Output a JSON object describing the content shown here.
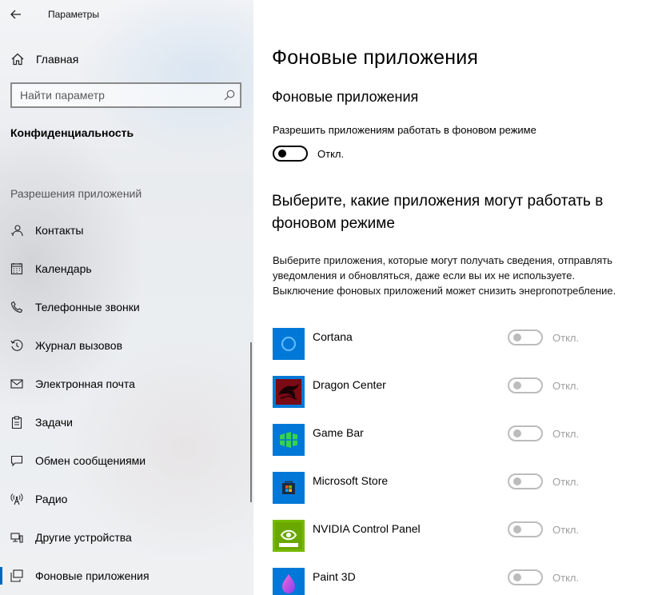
{
  "window": {
    "title": "Параметры"
  },
  "sidebar": {
    "home_label": "Главная",
    "search_placeholder": "Найти параметр",
    "section_title": "Конфиденциальность",
    "group_label": "Разрешения приложений",
    "items": [
      {
        "label": "Контакты",
        "icon": "contacts-icon"
      },
      {
        "label": "Календарь",
        "icon": "calendar-icon"
      },
      {
        "label": "Телефонные звонки",
        "icon": "phone-icon"
      },
      {
        "label": "Журнал вызовов",
        "icon": "history-icon"
      },
      {
        "label": "Электронная почта",
        "icon": "mail-icon"
      },
      {
        "label": "Задачи",
        "icon": "tasks-icon"
      },
      {
        "label": "Обмен сообщениями",
        "icon": "message-icon"
      },
      {
        "label": "Радио",
        "icon": "radio-icon"
      },
      {
        "label": "Другие устройства",
        "icon": "devices-icon"
      },
      {
        "label": "Фоновые приложения",
        "icon": "background-apps-icon",
        "active": true
      }
    ]
  },
  "main": {
    "page_title": "Фоновые приложения",
    "section_title": "Фоновые приложения",
    "allow_label": "Разрешить приложениям работать в фоновом режиме",
    "allow_state": "Откл.",
    "choose_title": "Выберите, какие приложения могут работать в фоновом режиме",
    "choose_description": "Выберите приложения, которые могут получать сведения, отправлять уведомления и обновляться, даже если вы их не используете. Выключение фоновых приложений может снизить энергопотребление.",
    "apps": [
      {
        "name": "Cortana",
        "state": "Откл.",
        "icon": "cortana-icon"
      },
      {
        "name": "Dragon Center",
        "state": "Откл.",
        "icon": "dragon-center-icon"
      },
      {
        "name": "Game Bar",
        "state": "Откл.",
        "icon": "game-bar-icon"
      },
      {
        "name": "Microsoft Store",
        "state": "Откл.",
        "icon": "microsoft-store-icon"
      },
      {
        "name": "NVIDIA Control Panel",
        "state": "Откл.",
        "icon": "nvidia-icon"
      },
      {
        "name": "Paint 3D",
        "state": "Откл.",
        "icon": "paint-3d-icon"
      }
    ]
  },
  "colors": {
    "accent": "#0078d7",
    "toggle_off": "#bcbcbc"
  }
}
